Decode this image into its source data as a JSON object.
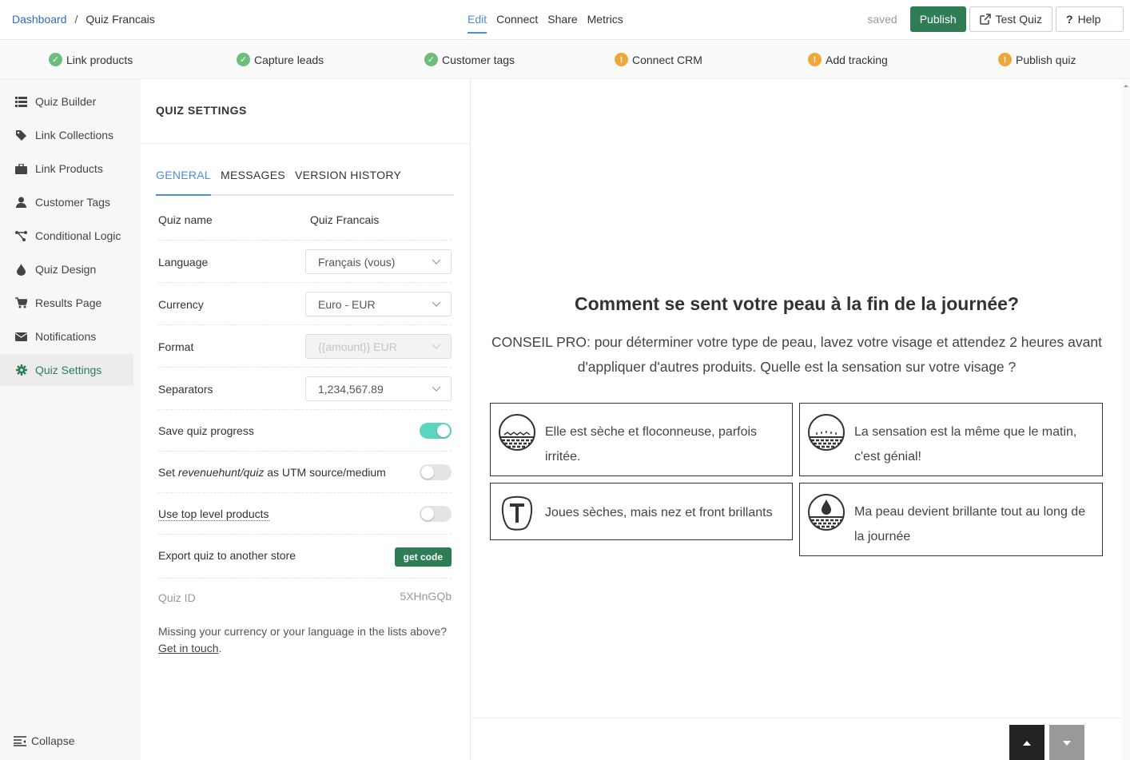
{
  "breadcrumb": {
    "root": "Dashboard",
    "separator": "/",
    "current": "Quiz Francais"
  },
  "topnav": {
    "items": [
      "Edit",
      "Connect",
      "Share",
      "Metrics"
    ],
    "active": "Edit"
  },
  "toolbar": {
    "status": "saved",
    "publish_label": "Publish",
    "test_label": "Test Quiz",
    "help_label": "Help"
  },
  "checklist": [
    {
      "label": "Link products",
      "status": "done"
    },
    {
      "label": "Capture leads",
      "status": "done"
    },
    {
      "label": "Customer tags",
      "status": "done"
    },
    {
      "label": "Connect CRM",
      "status": "todo"
    },
    {
      "label": "Add tracking",
      "status": "todo"
    },
    {
      "label": "Publish quiz",
      "status": "todo"
    }
  ],
  "sidebar": {
    "items": [
      {
        "label": "Quiz Builder",
        "icon": "list-icon"
      },
      {
        "label": "Link Collections",
        "icon": "tag-icon"
      },
      {
        "label": "Link Products",
        "icon": "briefcase-icon"
      },
      {
        "label": "Customer Tags",
        "icon": "user-icon"
      },
      {
        "label": "Conditional Logic",
        "icon": "branch-icon"
      },
      {
        "label": "Quiz Design",
        "icon": "droplet-icon"
      },
      {
        "label": "Results Page",
        "icon": "cart-icon"
      },
      {
        "label": "Notifications",
        "icon": "envelope-icon"
      },
      {
        "label": "Quiz Settings",
        "icon": "gear-icon"
      }
    ],
    "active": "Quiz Settings",
    "collapse_label": "Collapse"
  },
  "settings": {
    "title": "QUIZ SETTINGS",
    "tabs": [
      "GENERAL",
      "MESSAGES",
      "VERSION HISTORY"
    ],
    "active_tab": "GENERAL",
    "quiz_name_label": "Quiz name",
    "quiz_name_value": "Quiz Francais",
    "language_label": "Language",
    "language_value": "Français (vous)",
    "currency_label": "Currency",
    "currency_value": "Euro - EUR",
    "format_label": "Format",
    "format_value": "{{amount}} EUR",
    "separators_label": "Separators",
    "separators_value": "1,234,567.89",
    "save_progress_label": "Save quiz progress",
    "save_progress_on": true,
    "utm_prefix": "Set ",
    "utm_em": "revenuehunt/quiz",
    "utm_suffix": " as UTM source/medium",
    "utm_on": false,
    "top_level_label": "Use top level products",
    "top_level_on": false,
    "export_label": "Export quiz to another store",
    "export_button": "get code",
    "quiz_id_label": "Quiz ID",
    "quiz_id_value": "5XHnGQb",
    "note_text": "Missing your currency or your language in the lists above?",
    "note_link": "Get in touch",
    "note_end": "."
  },
  "preview": {
    "question": "Comment se sent votre peau à la fin de la journée?",
    "description": "CONSEIL PRO: pour déterminer votre type de peau, lavez votre visage et attendez 2 heures avant d'appliquer d'autres produits. Quelle est la sensation sur votre visage ?",
    "answers": [
      {
        "text": "Elle est sèche et floconneuse, parfois irritée.",
        "icon": "dry-skin-icon"
      },
      {
        "text": "La sensation est la même que le matin, c'est génial!",
        "icon": "normal-skin-icon"
      },
      {
        "text": "Joues sèches, mais nez et front brillants",
        "icon": "t-zone-icon"
      },
      {
        "text": "Ma peau devient brillante tout au long de la journée",
        "icon": "oily-skin-icon"
      }
    ]
  },
  "colors": {
    "brand_green": "#2e7d55",
    "accent_blue": "#4a90d9",
    "toggle_on": "#5bd6c0",
    "done": "#6bbf7a",
    "todo": "#f0a73a"
  }
}
